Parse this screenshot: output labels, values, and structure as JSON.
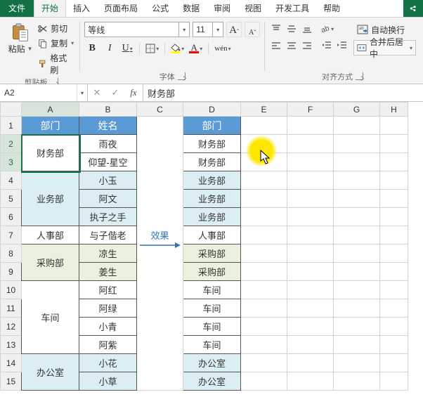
{
  "tabs": {
    "file": "文件",
    "home": "开始",
    "insert": "插入",
    "layout": "页面布局",
    "formulas": "公式",
    "data": "数据",
    "review": "审阅",
    "view": "视图",
    "dev": "开发工具",
    "help": "帮助"
  },
  "ribbon": {
    "paste": "粘贴",
    "cut": "剪切",
    "copy": "复制",
    "format_painter": "格式刷",
    "clipboard_group": "剪贴板",
    "font_name": "等线",
    "font_size": "11",
    "font_group": "字体",
    "wen_btn": "wén",
    "align_group": "对齐方式",
    "wrap_text": "自动换行",
    "merge_center": "合并后居中"
  },
  "namebox": "A2",
  "formula": "财务部",
  "columns": [
    "A",
    "B",
    "C",
    "D",
    "E",
    "F",
    "G",
    "H"
  ],
  "row_count": 15,
  "arrow_label": "效果",
  "table": {
    "header_dept": "部门",
    "header_name": "姓名",
    "rows": [
      {
        "dept": "财务部",
        "span": 2,
        "shade": "",
        "names": [
          "雨夜",
          "仰望-星空"
        ]
      },
      {
        "dept": "业务部",
        "span": 3,
        "shade": "shade-b",
        "names": [
          "小玉",
          "阿文",
          "执子之手"
        ]
      },
      {
        "dept": "人事部",
        "span": 1,
        "shade": "",
        "names": [
          "与子偕老"
        ]
      },
      {
        "dept": "采购部",
        "span": 2,
        "shade": "shade-a",
        "names": [
          "凉生",
          "姜生"
        ]
      },
      {
        "dept": "车间",
        "span": 4,
        "shade": "",
        "names": [
          "阿红",
          "阿绿",
          "小青",
          "阿紫"
        ]
      },
      {
        "dept": "办公室",
        "span": 2,
        "shade": "shade-b",
        "names": [
          "小花",
          "小草"
        ]
      }
    ]
  },
  "colD": {
    "header": "部门",
    "rows": [
      {
        "v": "财务部",
        "shade": ""
      },
      {
        "v": "财务部",
        "shade": ""
      },
      {
        "v": "业务部",
        "shade": "shade-b"
      },
      {
        "v": "业务部",
        "shade": "shade-b"
      },
      {
        "v": "业务部",
        "shade": "shade-b"
      },
      {
        "v": "人事部",
        "shade": ""
      },
      {
        "v": "采购部",
        "shade": "shade-a"
      },
      {
        "v": "采购部",
        "shade": "shade-a"
      },
      {
        "v": "车间",
        "shade": ""
      },
      {
        "v": "车间",
        "shade": ""
      },
      {
        "v": "车间",
        "shade": ""
      },
      {
        "v": "车间",
        "shade": ""
      },
      {
        "v": "办公室",
        "shade": "shade-b"
      },
      {
        "v": "办公室",
        "shade": "shade-b"
      }
    ]
  }
}
